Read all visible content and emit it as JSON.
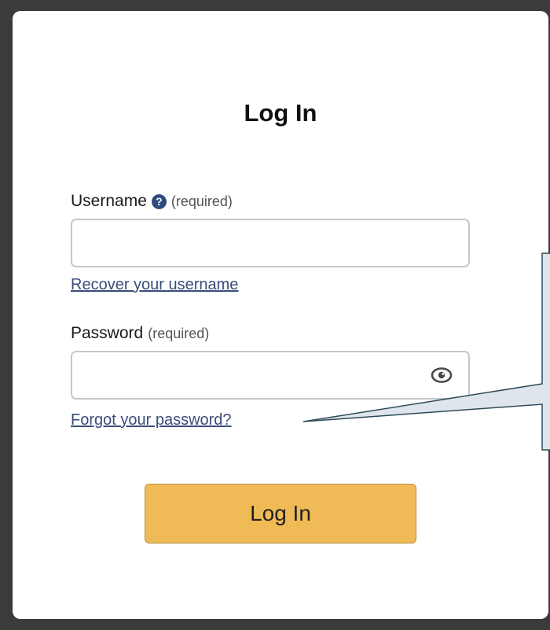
{
  "form": {
    "title": "Log In",
    "username": {
      "label": "Username",
      "help_icon": "?",
      "required_note": "(required)",
      "value": "",
      "placeholder": ""
    },
    "recover_username_link": "Recover your username",
    "password": {
      "label": "Password",
      "required_note": "(required)",
      "value": "",
      "placeholder": ""
    },
    "forgot_password_link": "Forgot your password?",
    "submit_label": "Log In"
  },
  "icons": {
    "help": "question-circle-icon",
    "show_password": "eye-icon"
  },
  "colors": {
    "button": "#f0bb57",
    "link": "#3a4d7a",
    "help_icon": "#2f4a7d",
    "callout_fill": "#dfe5ec",
    "callout_border": "#2c4b57"
  }
}
